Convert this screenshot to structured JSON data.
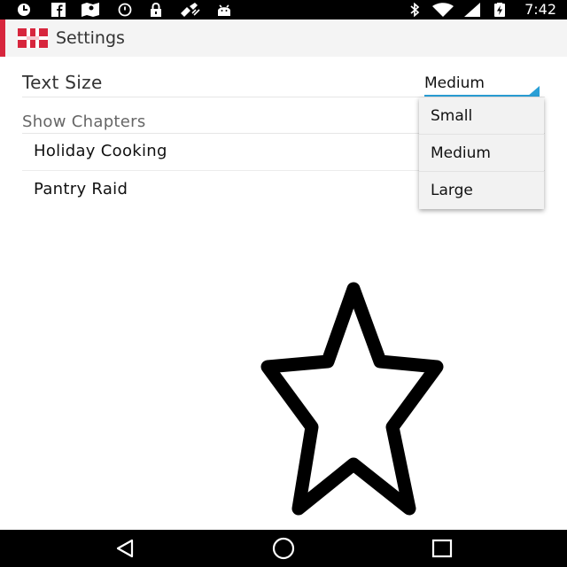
{
  "status_bar": {
    "time": "7:42",
    "icons": [
      "clock-icon",
      "facebook-icon",
      "maps-icon",
      "alarm-icon",
      "lock-icon",
      "satellite-icon",
      "android-icon",
      "bluetooth-icon",
      "wifi-icon",
      "signal-icon",
      "battery-charging-icon"
    ]
  },
  "action_bar": {
    "title": "Settings",
    "accent_color": "#d7263d"
  },
  "text_size": {
    "label": "Text Size",
    "selected": "Medium",
    "accent_color": "#2a9fd6"
  },
  "chapters": {
    "header": "Show Chapters",
    "items": [
      "Holiday Cooking",
      "Pantry Raid"
    ]
  },
  "dropdown": {
    "options": [
      "Small",
      "Medium",
      "Large"
    ]
  },
  "canvas": {
    "shape": "star-outline-icon"
  },
  "nav_bar": {
    "buttons": [
      "back-icon",
      "home-icon",
      "recents-icon"
    ]
  }
}
